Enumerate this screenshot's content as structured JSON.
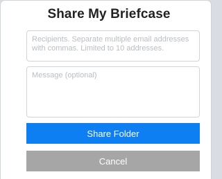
{
  "dialog": {
    "title": "Share My Briefcase",
    "recipients_placeholder": "Recipients. Separate multiple email addresses with commas. Limited to 10 addresses.",
    "recipients_value": "",
    "message_placeholder": "Message (optional)",
    "message_value": "",
    "share_label": "Share Folder",
    "cancel_label": "Cancel"
  },
  "colors": {
    "primary_button": "#0d7ff2",
    "secondary_button": "#a6a6a6",
    "background": "#d9dde3"
  }
}
